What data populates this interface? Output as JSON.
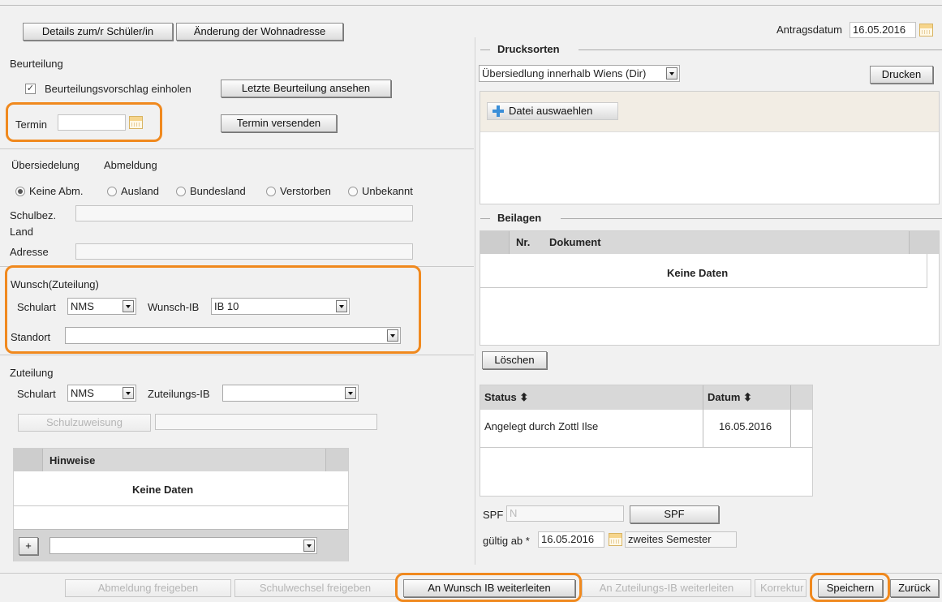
{
  "header": {
    "details_button": "Details zum/r Schüler/in",
    "address_button": "Änderung der Wohnadresse",
    "antragsdatum_label": "Antragsdatum",
    "antragsdatum_value": "16.05.2016"
  },
  "beurteilung": {
    "title": "Beurteilung",
    "checkbox_label": "Beurteilungsvorschlag einholen",
    "checkbox_mark": "✓",
    "letzte_button": "Letzte Beurteilung ansehen",
    "termin_label": "Termin",
    "termin_value": "",
    "termin_send_button": "Termin versenden"
  },
  "uebersiedelung": {
    "title": "Übersiedelung",
    "abmeldung_title": "Abmeldung",
    "options": [
      "Keine Abm.",
      "Ausland",
      "Bundesland",
      "Verstorben",
      "Unbekannt"
    ],
    "schulbez_label": "Schulbez.",
    "land_label": "Land",
    "adresse_label": "Adresse"
  },
  "wunsch": {
    "title": "Wunsch(Zuteilung)",
    "schulart_label": "Schulart",
    "schulart_value": "NMS",
    "wunsch_ib_label": "Wunsch-IB",
    "wunsch_ib_value": "IB 10",
    "standort_label": "Standort",
    "standort_value": ""
  },
  "zuteilung": {
    "title": "Zuteilung",
    "schulart_label": "Schulart",
    "schulart_value": "NMS",
    "zuteilungs_ib_label": "Zuteilungs-IB",
    "zuteilungs_ib_value": "",
    "schulzuweisung_button": "Schulzuweisung"
  },
  "hinweise": {
    "header": "Hinweise",
    "empty": "Keine Daten",
    "add_symbol": "+"
  },
  "drucksorten": {
    "title": "Drucksorten",
    "select_value": "Übersiedlung innerhalb Wiens (Dir)",
    "drucken_button": "Drucken",
    "datei_button": "Datei auswaehlen"
  },
  "beilagen": {
    "title": "Beilagen",
    "columns": [
      "Nr.",
      "Dokument"
    ],
    "empty": "Keine Daten",
    "loeschen_button": "Löschen"
  },
  "status_table": {
    "columns": [
      "Status ⬍",
      "Datum ⬍"
    ],
    "rows": [
      {
        "status": "Angelegt durch Zottl Ilse",
        "datum": "16.05.2016"
      }
    ]
  },
  "spf": {
    "label": "SPF",
    "value": "N",
    "button": "SPF",
    "gueltig_label": "gültig ab *",
    "gueltig_value": "16.05.2016",
    "semester_value": "zweites Semester"
  },
  "footer": {
    "abmeldung": "Abmeldung freigeben",
    "schulwechsel": "Schulwechsel freigeben",
    "wunsch_ib": "An Wunsch IB weiterleiten",
    "zuteilungs_ib": "An Zuteilungs-IB weiterleiten",
    "korrektur": "Korrektur",
    "speichern": "Speichern",
    "zurueck": "Zurück"
  },
  "colors": {
    "highlight": "#f0891e",
    "add_icon": "#3a8ed8"
  }
}
